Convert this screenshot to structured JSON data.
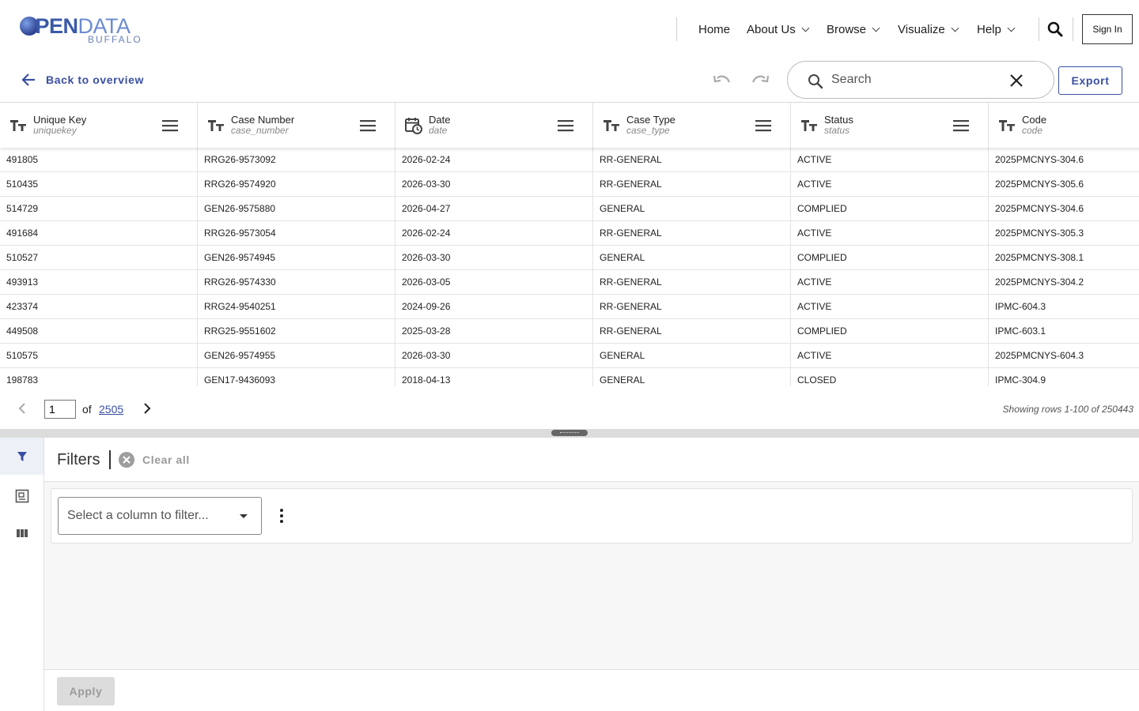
{
  "nav": {
    "logo_prefix": "PEN",
    "logo_word": "DATA",
    "logo_city": "BUFFALO",
    "items": [
      {
        "label": "Home"
      },
      {
        "label": "About Us"
      },
      {
        "label": "Browse"
      },
      {
        "label": "Visualize"
      },
      {
        "label": "Help"
      }
    ],
    "signin_label": "Sign In"
  },
  "toolbar": {
    "back_label": "Back to overview",
    "search_placeholder": "Search",
    "export_label": "Export"
  },
  "grid": {
    "columns": [
      {
        "title": "Unique Key",
        "field": "uniquekey",
        "icon": "text-type-icon"
      },
      {
        "title": "Case Number",
        "field": "case_number",
        "icon": "text-type-icon"
      },
      {
        "title": "Date",
        "field": "date",
        "icon": "calendar-clock-icon"
      },
      {
        "title": "Case Type",
        "field": "case_type",
        "icon": "text-type-icon"
      },
      {
        "title": "Status",
        "field": "status",
        "icon": "text-type-icon"
      },
      {
        "title": "Code",
        "field": "code",
        "icon": "text-type-icon"
      }
    ],
    "rows": [
      [
        "491805",
        "RRG26-9573092",
        "2026-02-24",
        "RR-GENERAL",
        "ACTIVE",
        "2025PMCNYS-304.6"
      ],
      [
        "510435",
        "RRG26-9574920",
        "2026-03-30",
        "RR-GENERAL",
        "ACTIVE",
        "2025PMCNYS-305.6"
      ],
      [
        "514729",
        "GEN26-9575880",
        "2026-04-27",
        "GENERAL",
        "COMPLIED",
        "2025PMCNYS-304.6"
      ],
      [
        "491684",
        "RRG26-9573054",
        "2026-02-24",
        "RR-GENERAL",
        "ACTIVE",
        "2025PMCNYS-305.3"
      ],
      [
        "510527",
        "GEN26-9574945",
        "2026-03-30",
        "GENERAL",
        "COMPLIED",
        "2025PMCNYS-308.1"
      ],
      [
        "493913",
        "RRG26-9574330",
        "2026-03-05",
        "RR-GENERAL",
        "ACTIVE",
        "2025PMCNYS-304.2"
      ],
      [
        "423374",
        "RRG24-9540251",
        "2024-09-26",
        "RR-GENERAL",
        "ACTIVE",
        "IPMC-604.3"
      ],
      [
        "449508",
        "RRG25-9551602",
        "2025-03-28",
        "RR-GENERAL",
        "COMPLIED",
        "IPMC-603.1"
      ],
      [
        "510575",
        "GEN26-9574955",
        "2026-03-30",
        "GENERAL",
        "ACTIVE",
        "2025PMCNYS-604.3"
      ],
      [
        "198783",
        "GEN17-9436093",
        "2018-04-13",
        "GENERAL",
        "CLOSED",
        "IPMC-304.9"
      ]
    ]
  },
  "pager": {
    "page": "1",
    "of_label": "of",
    "total_pages": "2505",
    "info": "Showing rows 1-100 of 250443"
  },
  "filters": {
    "title": "Filters",
    "clear_all_label": "Clear all",
    "select_placeholder": "Select a column to filter...",
    "apply_label": "Apply"
  },
  "colors": {
    "accent": "#3a4fa2",
    "side_active_bg": "#eef0f8"
  }
}
